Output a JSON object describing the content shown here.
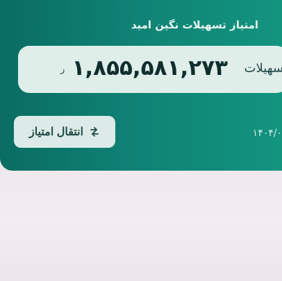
{
  "card": {
    "title": "امتیاز تسهیلات نگین امید",
    "balance": {
      "label": "تسهیلات",
      "value": "۱,۸۵۵,۵۸۱,۲۷۳",
      "currency": "ر"
    },
    "transfer_button": {
      "label": "انتقال امتیاز",
      "icon": "transfer-icon"
    },
    "date": "۱۴۰۴/۰"
  },
  "colors": {
    "card_start": "#0a6c62",
    "card_end": "#12947f",
    "pill": "#dfeee9",
    "page_background": "#ece7ea"
  }
}
